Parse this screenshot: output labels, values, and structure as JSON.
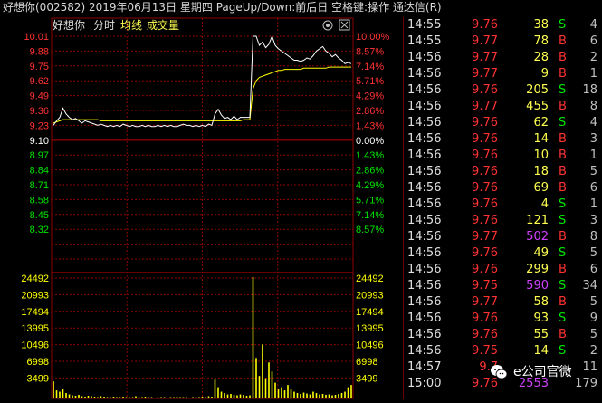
{
  "title": "好想你(002582)  2019年06月13日 星期四 PageUp/Down:前后日 空格键:操作 通达信(R)",
  "chart_header": {
    "stock_name": "好想你",
    "mode": "分时",
    "avg_line": "均线",
    "volume_label": "成交量"
  },
  "colors": {
    "up": "#ff3232",
    "down": "#00e600",
    "flat": "#ffffff",
    "grid": "#8b0000",
    "price_line": "#ffffff",
    "avg_line": "#ffff00",
    "volume": "#ffff00"
  },
  "chart_data": {
    "type": "line",
    "prev_close": 9.1,
    "price_ticks": [
      "10.01",
      "9.88",
      "9.75",
      "9.62",
      "9.49",
      "9.36",
      "9.23",
      "9.10",
      "8.97",
      "8.84",
      "8.71",
      "8.58",
      "8.45",
      "8.32"
    ],
    "pct_ticks": [
      "10.00%",
      "8.57%",
      "7.14%",
      "5.71%",
      "4.29%",
      "2.86%",
      "1.43%",
      "0.00%",
      "1.43%",
      "2.86%",
      "4.29%",
      "5.71%",
      "7.14%",
      "8.57%"
    ],
    "ylim": [
      8.19,
      10.01
    ],
    "volume_ticks": [
      "24492",
      "20993",
      "17494",
      "13995",
      "10496",
      "6998",
      "3499"
    ],
    "volume_ylim": [
      0,
      27991
    ],
    "price_series": [
      9.23,
      9.27,
      9.3,
      9.38,
      9.33,
      9.3,
      9.28,
      9.29,
      9.27,
      9.25,
      9.27,
      9.26,
      9.25,
      9.24,
      9.23,
      9.24,
      9.23,
      9.22,
      9.23,
      9.22,
      9.23,
      9.22,
      9.24,
      9.23,
      9.22,
      9.23,
      9.22,
      9.22,
      9.23,
      9.22,
      9.23,
      9.22,
      9.22,
      9.23,
      9.22,
      9.23,
      9.22,
      9.23,
      9.22,
      9.22,
      9.23,
      9.24,
      9.23,
      9.23,
      9.22,
      9.23,
      9.22,
      9.23,
      9.22,
      9.24,
      9.23,
      9.33,
      9.37,
      9.32,
      9.29,
      9.3,
      9.28,
      9.31,
      9.28,
      9.3,
      9.3,
      9.3,
      9.3,
      10.01,
      10.01,
      9.93,
      9.96,
      9.91,
      9.94,
      10.01,
      9.93,
      9.9,
      9.88,
      9.86,
      9.84,
      9.82,
      9.8,
      9.8,
      9.79,
      9.8,
      9.82,
      9.81,
      9.84,
      9.88,
      9.9,
      9.92,
      9.88,
      9.86,
      9.83,
      9.85,
      9.82,
      9.8,
      9.77,
      9.78,
      9.77
    ],
    "avg_series": [
      9.25,
      9.26,
      9.27,
      9.28,
      9.28,
      9.28,
      9.28,
      9.28,
      9.28,
      9.28,
      9.28,
      9.28,
      9.28,
      9.28,
      9.28,
      9.27,
      9.27,
      9.27,
      9.27,
      9.27,
      9.27,
      9.27,
      9.27,
      9.27,
      9.27,
      9.27,
      9.27,
      9.27,
      9.27,
      9.27,
      9.27,
      9.27,
      9.27,
      9.27,
      9.27,
      9.27,
      9.27,
      9.27,
      9.27,
      9.27,
      9.27,
      9.27,
      9.27,
      9.27,
      9.27,
      9.27,
      9.27,
      9.27,
      9.27,
      9.27,
      9.27,
      9.27,
      9.27,
      9.27,
      9.27,
      9.27,
      9.27,
      9.27,
      9.27,
      9.27,
      9.28,
      9.28,
      9.28,
      9.55,
      9.62,
      9.65,
      9.66,
      9.67,
      9.68,
      9.69,
      9.7,
      9.71,
      9.71,
      9.72,
      9.72,
      9.72,
      9.72,
      9.72,
      9.72,
      9.73,
      9.73,
      9.73,
      9.73,
      9.73,
      9.73,
      9.73,
      9.73,
      9.74,
      9.74,
      9.74,
      9.74,
      9.74,
      9.74,
      9.74,
      9.74
    ],
    "volume_series": [
      3800,
      1800,
      1500,
      2200,
      1200,
      900,
      700,
      600,
      800,
      500,
      400,
      600,
      500,
      400,
      300,
      500,
      400,
      300,
      300,
      400,
      300,
      300,
      400,
      300,
      300,
      300,
      500,
      300,
      300,
      400,
      300,
      300,
      200,
      300,
      300,
      300,
      200,
      300,
      300,
      400,
      300,
      300,
      300,
      200,
      300,
      300,
      300,
      400,
      300,
      500,
      400,
      4200,
      2500,
      1500,
      1200,
      900,
      1000,
      800,
      700,
      900,
      800,
      600,
      700,
      27000,
      9000,
      5000,
      12000,
      4500,
      8000,
      6000,
      3500,
      2000,
      2500,
      1800,
      3000,
      2000,
      1500,
      1200,
      1000,
      1300,
      1100,
      900,
      1500,
      1200,
      900,
      1000,
      800,
      900,
      700,
      800,
      1000,
      1200,
      1500,
      2500,
      3000
    ],
    "grid": true
  },
  "trades": [
    {
      "time": "14:55",
      "price": "9.76",
      "vol": "38",
      "bs": "S",
      "cnt": "4"
    },
    {
      "time": "14:55",
      "price": "9.77",
      "vol": "78",
      "bs": "B",
      "cnt": "6"
    },
    {
      "time": "14:56",
      "price": "9.77",
      "vol": "28",
      "bs": "B",
      "cnt": "2"
    },
    {
      "time": "14:56",
      "price": "9.77",
      "vol": "9",
      "bs": "B",
      "cnt": "1"
    },
    {
      "time": "14:56",
      "price": "9.76",
      "vol": "205",
      "bs": "S",
      "cnt": "18"
    },
    {
      "time": "14:56",
      "price": "9.77",
      "vol": "455",
      "bs": "B",
      "cnt": "8"
    },
    {
      "time": "14:56",
      "price": "9.76",
      "vol": "62",
      "bs": "S",
      "cnt": "4"
    },
    {
      "time": "14:56",
      "price": "9.76",
      "vol": "14",
      "bs": "B",
      "cnt": "3"
    },
    {
      "time": "14:56",
      "price": "9.76",
      "vol": "10",
      "bs": "B",
      "cnt": "1"
    },
    {
      "time": "14:56",
      "price": "9.76",
      "vol": "18",
      "bs": "B",
      "cnt": "5"
    },
    {
      "time": "14:56",
      "price": "9.76",
      "vol": "69",
      "bs": "B",
      "cnt": "6"
    },
    {
      "time": "14:56",
      "price": "9.76",
      "vol": "4",
      "bs": "S",
      "cnt": "1"
    },
    {
      "time": "14:56",
      "price": "9.76",
      "vol": "121",
      "bs": "S",
      "cnt": "3"
    },
    {
      "time": "14:56",
      "price": "9.77",
      "vol": "502",
      "bs": "B",
      "cnt": "8"
    },
    {
      "time": "14:56",
      "price": "9.76",
      "vol": "49",
      "bs": "S",
      "cnt": "5"
    },
    {
      "time": "14:56",
      "price": "9.76",
      "vol": "299",
      "bs": "B",
      "cnt": "6"
    },
    {
      "time": "14:56",
      "price": "9.75",
      "vol": "590",
      "bs": "S",
      "cnt": "34"
    },
    {
      "time": "14:56",
      "price": "9.77",
      "vol": "58",
      "bs": "B",
      "cnt": "5"
    },
    {
      "time": "14:56",
      "price": "9.76",
      "vol": "93",
      "bs": "S",
      "cnt": "9"
    },
    {
      "time": "14:56",
      "price": "9.76",
      "vol": "55",
      "bs": "B",
      "cnt": "5"
    },
    {
      "time": "14:56",
      "price": "9.75",
      "vol": "14",
      "bs": "S",
      "cnt": "2"
    },
    {
      "time": "14:57",
      "price": "9.7",
      "vol": "",
      "bs": "",
      "cnt": "11"
    },
    {
      "time": "15:00",
      "price": "9.76",
      "vol": "2553",
      "bs": "",
      "cnt": "179"
    }
  ],
  "watermark": {
    "icon": "wechat-icon",
    "text": "e公司官微"
  }
}
